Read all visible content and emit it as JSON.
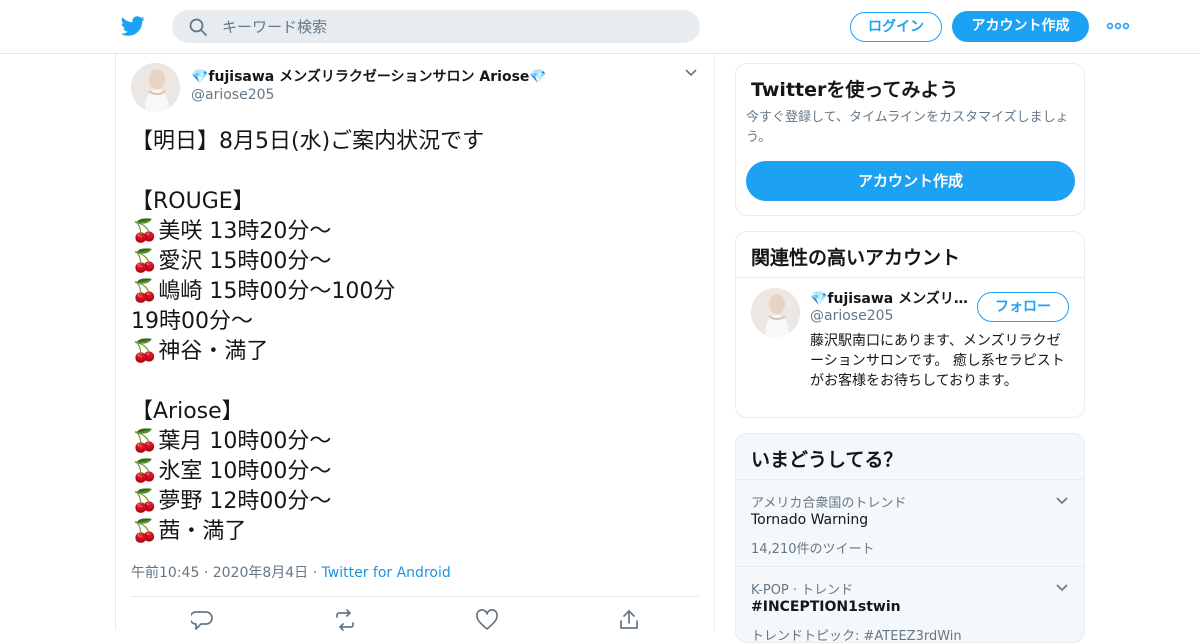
{
  "header": {
    "logo_icon": "twitter-bird-icon",
    "search_placeholder": "キーワード検索",
    "login_label": "ログイン",
    "signup_label": "アカウント作成",
    "more_icon": "more-dots-icon",
    "brand_color": "#1da1f2"
  },
  "tweet": {
    "author_name": "💎fujisawa メンズリラクゼーションサロン Ariose💎",
    "author_handle": "@ariose205",
    "text": "【明日】8月5日(水)ご案内状況です\n\n【ROUGE】\n🍒美咲 13時20分～\n🍒愛沢 15時00分～\n🍒嶋崎 15時00分～100分\n19時00分～\n🍒神谷・満了\n\n【Ariose】\n🍒葉月 10時00分～\n🍒氷室 10時00分～\n🍒夢野 12時00分～\n🍒茜・満了",
    "time": "午前10:45",
    "date": "2020年8月4日",
    "source": "Twitter for Android",
    "sep": "·",
    "actions": [
      "reply-icon",
      "retweet-icon",
      "like-icon",
      "share-icon"
    ]
  },
  "sidebar": {
    "try": {
      "title": "Twitterを使ってみよう",
      "desc": "今すぐ登録して、タイムラインをカスタマイズしましょう。",
      "cta": "アカウント作成"
    },
    "related": {
      "title": "関連性の高いアカウント",
      "name": "💎fujisawa メンズリラクゼーションサロン Ariose💎",
      "handle": "@ariose205",
      "follow_label": "フォロー",
      "bio": "藤沢駅南口にあります、メンズリラクゼーションサロンです。 癒し系セラピストがお客様をお待ちしております。"
    },
    "trends": {
      "title": "いまどうしてる？",
      "items": [
        {
          "category": "アメリカ合衆国のトレンド",
          "name": "Tornado Warning",
          "count": "14,210件のツイート"
        },
        {
          "category": "K-POP · トレンド",
          "name": "#INCEPTION1stwin",
          "count": "トレンドトピック: #ATEEZ3rdWin"
        }
      ]
    }
  }
}
